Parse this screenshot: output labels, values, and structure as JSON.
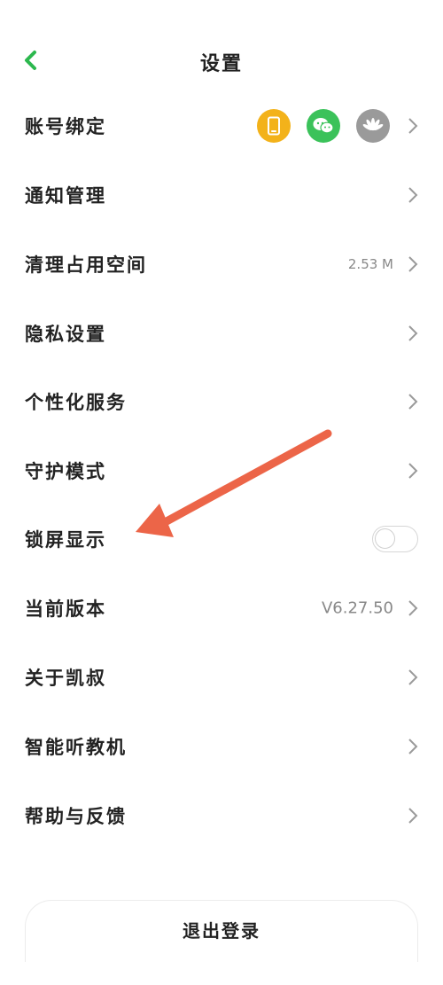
{
  "header": {
    "title": "设置"
  },
  "colors": {
    "accent": "#2cb84e",
    "phone_badge": "#f3b21a",
    "wechat_badge": "#3bc25a",
    "huawei_badge": "#9a9a9a",
    "arrow": "#ec6548"
  },
  "settings": {
    "account": {
      "label": "账号绑定",
      "icons": [
        "phone-icon",
        "wechat-icon",
        "huawei-icon"
      ]
    },
    "notification": {
      "label": "通知管理"
    },
    "storage": {
      "label": "清理占用空间",
      "value": "2.53 M"
    },
    "privacy": {
      "label": "隐私设置"
    },
    "personalized": {
      "label": "个性化服务"
    },
    "guardian": {
      "label": "守护模式"
    },
    "lockscreen": {
      "label": "锁屏显示",
      "enabled": false
    },
    "version": {
      "label": "当前版本",
      "value": "V6.27.50"
    },
    "about": {
      "label": "关于凯叔"
    },
    "smart_player": {
      "label": "智能听教机"
    },
    "help": {
      "label": "帮助与反馈"
    }
  },
  "logout": {
    "label": "退出登录"
  }
}
